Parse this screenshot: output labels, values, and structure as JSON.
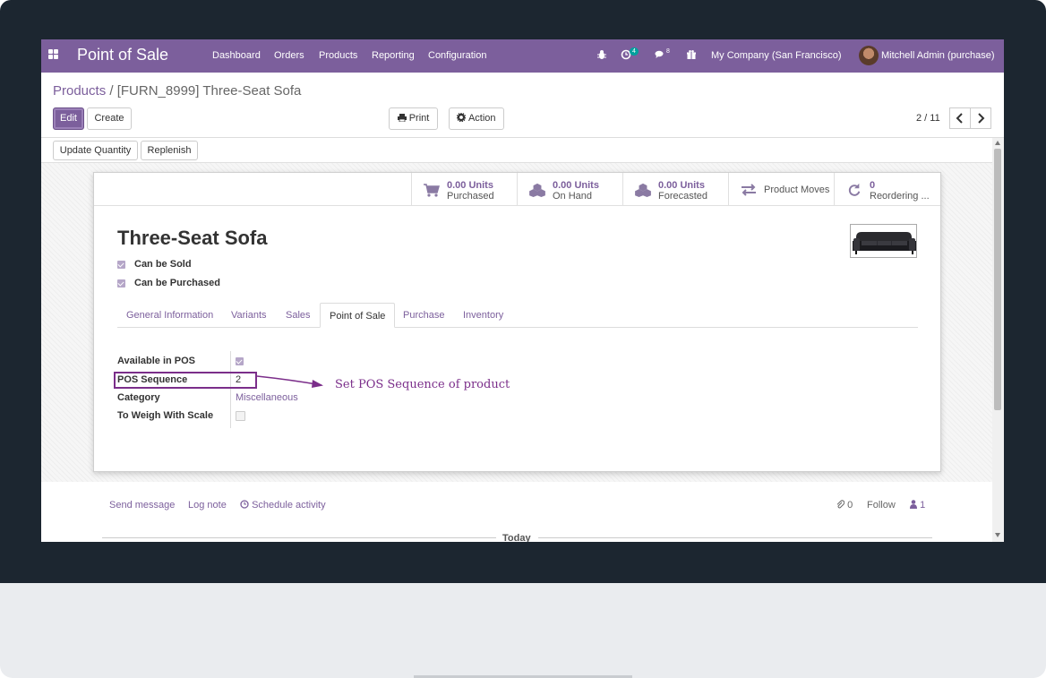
{
  "navbar": {
    "app_title": "Point of Sale",
    "menu": [
      "Dashboard",
      "Orders",
      "Products",
      "Reporting",
      "Configuration"
    ],
    "activity_badge": "4",
    "messages_badge": "8",
    "company": "My Company (San Francisco)",
    "user": "Mitchell Admin (purchase)"
  },
  "breadcrumb": {
    "parent": "Products",
    "separator": "/",
    "current": "[FURN_8999] Three-Seat Sofa"
  },
  "control": {
    "edit_label": "Edit",
    "create_label": "Create",
    "print_label": "Print",
    "action_label": "Action",
    "pager": "2 / 11"
  },
  "statusbar": {
    "update_quantity": "Update Quantity",
    "replenish": "Replenish"
  },
  "smart_buttons": {
    "purchased_value": "0.00 Units",
    "purchased_label": "Purchased",
    "onhand_value": "0.00 Units",
    "onhand_label": "On Hand",
    "forecasted_value": "0.00 Units",
    "forecasted_label": "Forecasted",
    "moves_label": "Product Moves",
    "reordering_value": "0",
    "reordering_label": "Reordering ..."
  },
  "product": {
    "name": "Three-Seat Sofa",
    "can_be_sold": "Can be Sold",
    "can_be_purchased": "Can be Purchased"
  },
  "tabs": [
    "General Information",
    "Variants",
    "Sales",
    "Point of Sale",
    "Purchase",
    "Inventory"
  ],
  "pos_fields": {
    "available_label": "Available in POS",
    "sequence_label": "POS Sequence",
    "sequence_value": "2",
    "category_label": "Category",
    "category_value": "Miscellaneous",
    "weigh_label": "To Weigh With Scale"
  },
  "annotation": "Set POS Sequence of product",
  "chatter": {
    "send_message": "Send message",
    "log_note": "Log note",
    "schedule_activity": "Schedule activity",
    "attachments": "0",
    "follow": "Follow",
    "followers": "1",
    "today": "Today"
  },
  "colors": {
    "brand": "#7c5f9c",
    "annotation": "#7b2e8a"
  }
}
